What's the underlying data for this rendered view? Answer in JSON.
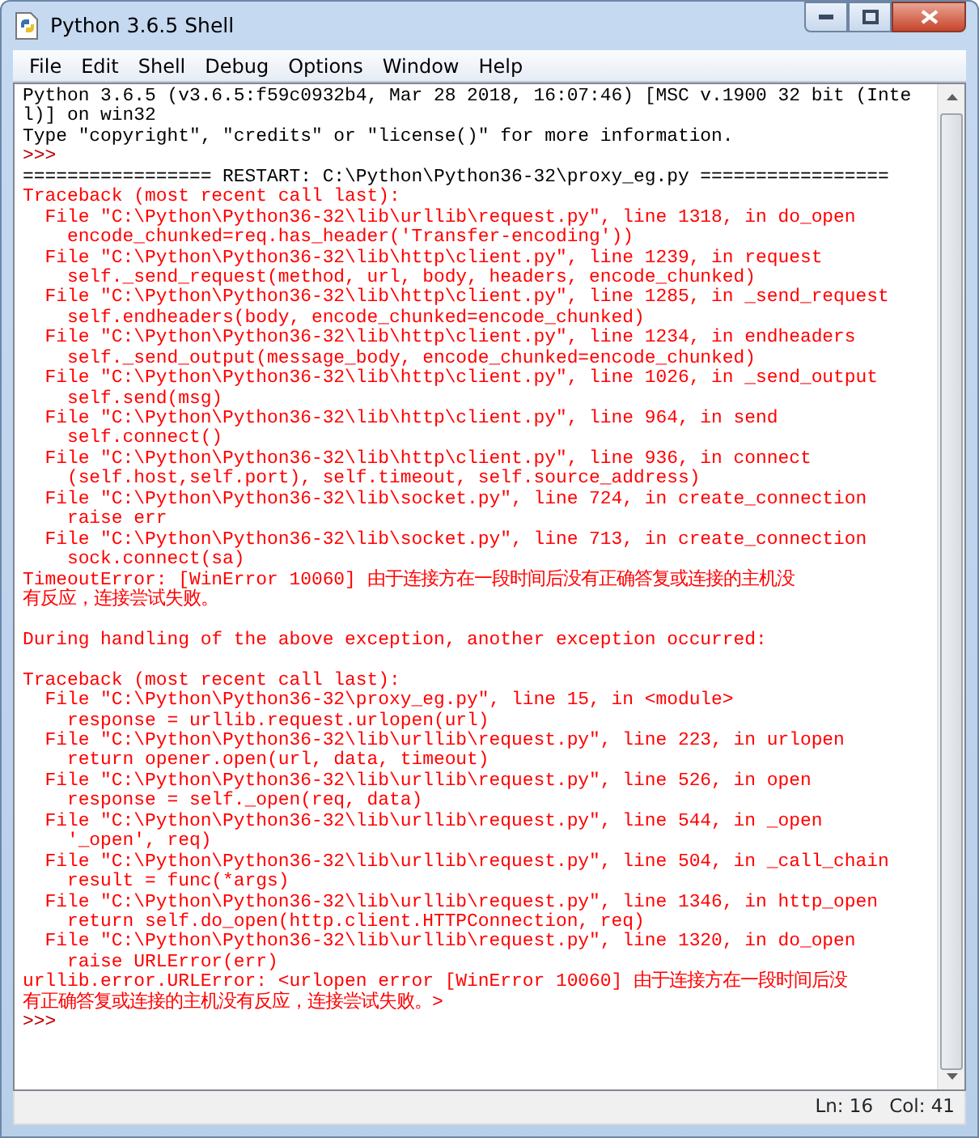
{
  "window": {
    "title": "Python 3.6.5 Shell"
  },
  "menu": [
    "File",
    "Edit",
    "Shell",
    "Debug",
    "Options",
    "Window",
    "Help"
  ],
  "shell": {
    "lines": [
      {
        "kind": "output",
        "text": "Python 3.6.5 (v3.6.5:f59c0932b4, Mar 28 2018, 16:07:46) [MSC v.1900 32 bit (Inte"
      },
      {
        "kind": "output",
        "text": "l)] on win32"
      },
      {
        "kind": "output",
        "text": "Type \"copyright\", \"credits\" or \"license()\" for more information."
      },
      {
        "kind": "prompt",
        "text": ">>>"
      },
      {
        "kind": "output",
        "text": "================= RESTART: C:\\Python\\Python36-32\\proxy_eg.py ================="
      },
      {
        "kind": "error",
        "text": "Traceback (most recent call last):"
      },
      {
        "kind": "error",
        "text": "  File \"C:\\Python\\Python36-32\\lib\\urllib\\request.py\", line 1318, in do_open"
      },
      {
        "kind": "error",
        "text": "    encode_chunked=req.has_header('Transfer-encoding'))"
      },
      {
        "kind": "error",
        "text": "  File \"C:\\Python\\Python36-32\\lib\\http\\client.py\", line 1239, in request"
      },
      {
        "kind": "error",
        "text": "    self._send_request(method, url, body, headers, encode_chunked)"
      },
      {
        "kind": "error",
        "text": "  File \"C:\\Python\\Python36-32\\lib\\http\\client.py\", line 1285, in _send_request"
      },
      {
        "kind": "error",
        "text": "    self.endheaders(body, encode_chunked=encode_chunked)"
      },
      {
        "kind": "error",
        "text": "  File \"C:\\Python\\Python36-32\\lib\\http\\client.py\", line 1234, in endheaders"
      },
      {
        "kind": "error",
        "text": "    self._send_output(message_body, encode_chunked=encode_chunked)"
      },
      {
        "kind": "error",
        "text": "  File \"C:\\Python\\Python36-32\\lib\\http\\client.py\", line 1026, in _send_output"
      },
      {
        "kind": "error",
        "text": "    self.send(msg)"
      },
      {
        "kind": "error",
        "text": "  File \"C:\\Python\\Python36-32\\lib\\http\\client.py\", line 964, in send"
      },
      {
        "kind": "error",
        "text": "    self.connect()"
      },
      {
        "kind": "error",
        "text": "  File \"C:\\Python\\Python36-32\\lib\\http\\client.py\", line 936, in connect"
      },
      {
        "kind": "error",
        "text": "    (self.host,self.port), self.timeout, self.source_address)"
      },
      {
        "kind": "error",
        "text": "  File \"C:\\Python\\Python36-32\\lib\\socket.py\", line 724, in create_connection"
      },
      {
        "kind": "error",
        "text": "    raise err"
      },
      {
        "kind": "error",
        "text": "  File \"C:\\Python\\Python36-32\\lib\\socket.py\", line 713, in create_connection"
      },
      {
        "kind": "error",
        "text": "    sock.connect(sa)"
      },
      {
        "kind": "error",
        "text": "TimeoutError: [WinError 10060] 由于连接方在一段时间后没有正确答复或连接的主机没"
      },
      {
        "kind": "error",
        "text": "有反应，连接尝试失败。"
      },
      {
        "kind": "blank"
      },
      {
        "kind": "error",
        "text": "During handling of the above exception, another exception occurred:"
      },
      {
        "kind": "blank"
      },
      {
        "kind": "error",
        "text": "Traceback (most recent call last):"
      },
      {
        "kind": "error",
        "text": "  File \"C:\\Python\\Python36-32\\proxy_eg.py\", line 15, in <module>"
      },
      {
        "kind": "error",
        "text": "    response = urllib.request.urlopen(url)"
      },
      {
        "kind": "error",
        "text": "  File \"C:\\Python\\Python36-32\\lib\\urllib\\request.py\", line 223, in urlopen"
      },
      {
        "kind": "error",
        "text": "    return opener.open(url, data, timeout)"
      },
      {
        "kind": "error",
        "text": "  File \"C:\\Python\\Python36-32\\lib\\urllib\\request.py\", line 526, in open"
      },
      {
        "kind": "error",
        "text": "    response = self._open(req, data)"
      },
      {
        "kind": "error",
        "text": "  File \"C:\\Python\\Python36-32\\lib\\urllib\\request.py\", line 544, in _open"
      },
      {
        "kind": "error",
        "text": "    '_open', req)"
      },
      {
        "kind": "error",
        "text": "  File \"C:\\Python\\Python36-32\\lib\\urllib\\request.py\", line 504, in _call_chain"
      },
      {
        "kind": "error",
        "text": "    result = func(*args)"
      },
      {
        "kind": "error",
        "text": "  File \"C:\\Python\\Python36-32\\lib\\urllib\\request.py\", line 1346, in http_open"
      },
      {
        "kind": "error",
        "text": "    return self.do_open(http.client.HTTPConnection, req)"
      },
      {
        "kind": "error",
        "text": "  File \"C:\\Python\\Python36-32\\lib\\urllib\\request.py\", line 1320, in do_open"
      },
      {
        "kind": "error",
        "text": "    raise URLError(err)"
      },
      {
        "kind": "error",
        "text": "urllib.error.URLError: <urlopen error [WinError 10060] 由于连接方在一段时间后没"
      },
      {
        "kind": "error",
        "text": "有正确答复或连接的主机没有反应，连接尝试失败。>"
      },
      {
        "kind": "prompt",
        "text": ">>>"
      }
    ]
  },
  "status_bar": {
    "line": "Ln: 16",
    "column": "Col: 41"
  }
}
